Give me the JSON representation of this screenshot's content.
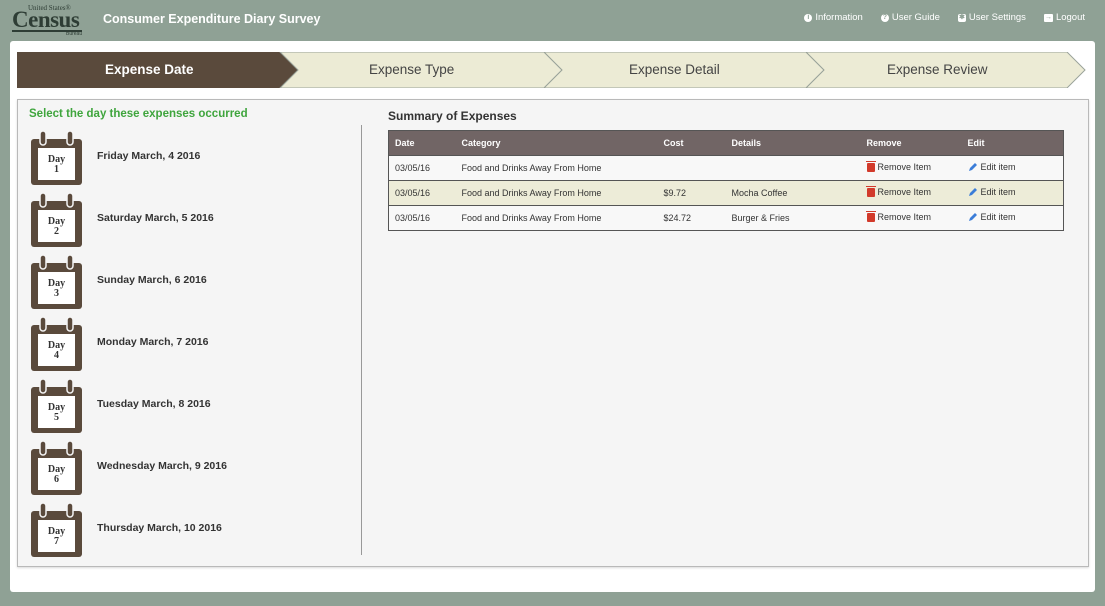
{
  "logo": {
    "top_text": "United States",
    "registered": "®",
    "main_text": "Census",
    "bottom_text": "Bureau"
  },
  "app_title": "Consumer Expenditure Diary Survey",
  "nav": [
    {
      "label": "Information",
      "icon": "info-circle-icon"
    },
    {
      "label": "User Guide",
      "icon": "question-circle-icon"
    },
    {
      "label": "User Settings",
      "icon": "gear-icon"
    },
    {
      "label": "Logout",
      "icon": "logout-icon"
    }
  ],
  "steps": [
    {
      "label": "Expense Date",
      "active": true
    },
    {
      "label": "Expense Type",
      "active": false
    },
    {
      "label": "Expense Detail",
      "active": false
    },
    {
      "label": "Expense Review",
      "active": false
    }
  ],
  "day_panel": {
    "title": "Select the day these expenses occurred",
    "day_word": "Day",
    "days": [
      {
        "number": "1",
        "date": "Friday March, 4 2016"
      },
      {
        "number": "2",
        "date": "Saturday March, 5 2016"
      },
      {
        "number": "3",
        "date": "Sunday March, 6 2016"
      },
      {
        "number": "4",
        "date": "Monday March, 7 2016"
      },
      {
        "number": "5",
        "date": "Tuesday March, 8 2016"
      },
      {
        "number": "6",
        "date": "Wednesday March, 9 2016"
      },
      {
        "number": "7",
        "date": "Thursday March, 10 2016"
      }
    ]
  },
  "summary": {
    "title": "Summary of Expenses",
    "columns": [
      "Date",
      "Category",
      "Cost",
      "Details",
      "Remove",
      "Edit"
    ],
    "rows": [
      {
        "date": "03/05/16",
        "category": "Food and Drinks Away From Home",
        "cost": "",
        "details": "",
        "remove": "Remove Item",
        "edit": "Edit item"
      },
      {
        "date": "03/05/16",
        "category": "Food and Drinks Away From Home",
        "cost": "$9.72",
        "details": "Mocha Coffee",
        "remove": "Remove Item",
        "edit": "Edit item"
      },
      {
        "date": "03/05/16",
        "category": "Food and Drinks Away From Home",
        "cost": "$24.72",
        "details": "Burger & Fries",
        "remove": "Remove Item",
        "edit": "Edit item"
      }
    ]
  },
  "colors": {
    "header_bg": "#8fa195",
    "step_active": "#5a4a3c",
    "step_inactive": "#ecebd5",
    "accent_green": "#3fa53d",
    "table_header": "#716565",
    "row_highlight": "#edecd8",
    "trash_red": "#d23a2b",
    "pencil_blue": "#3b7dd8"
  }
}
